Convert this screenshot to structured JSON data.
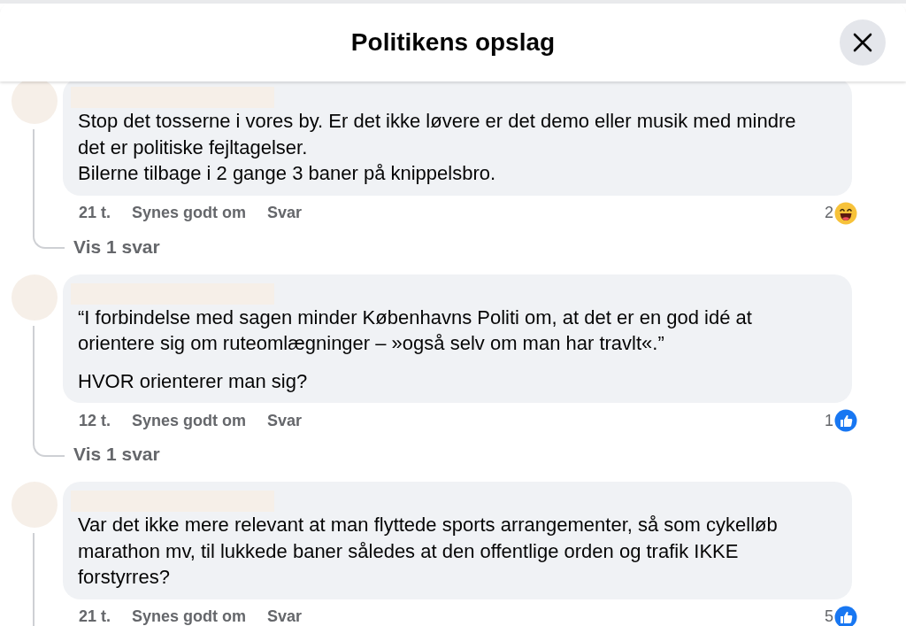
{
  "header": {
    "title": "Politikens opslag"
  },
  "comments": [
    {
      "paragraphs": [
        "Stop det tosserne i vores by. Er det ikke løvere er det demo eller musik med mindre det er politiske fejltagelser.\nBilerne tilbage i 2 gange 3 baner på knippelsbro."
      ],
      "time": "21 t.",
      "like_label": "Synes godt om",
      "reply_label": "Svar",
      "reaction": {
        "count": "2",
        "kind": "haha"
      },
      "replies_link": "Vis 1 svar"
    },
    {
      "paragraphs": [
        "“I forbindelse med sagen minder Københavns Politi om, at det er en god idé at orientere sig om ruteomlægninger – »også selv om man har travlt«.”",
        "HVOR orienterer man sig?"
      ],
      "time": "12 t.",
      "like_label": "Synes godt om",
      "reply_label": "Svar",
      "reaction": {
        "count": "1",
        "kind": "like"
      },
      "replies_link": "Vis 1 svar"
    },
    {
      "paragraphs": [
        "Var det ikke mere relevant at man flyttede sports arrangementer, så som cykelløb marathon mv, til lukkede baner således at den offentlige orden og trafik IKKE forstyrres?"
      ],
      "time": "21 t.",
      "like_label": "Synes godt om",
      "reply_label": "Svar",
      "reaction": {
        "count": "5",
        "kind": "like"
      }
    }
  ]
}
